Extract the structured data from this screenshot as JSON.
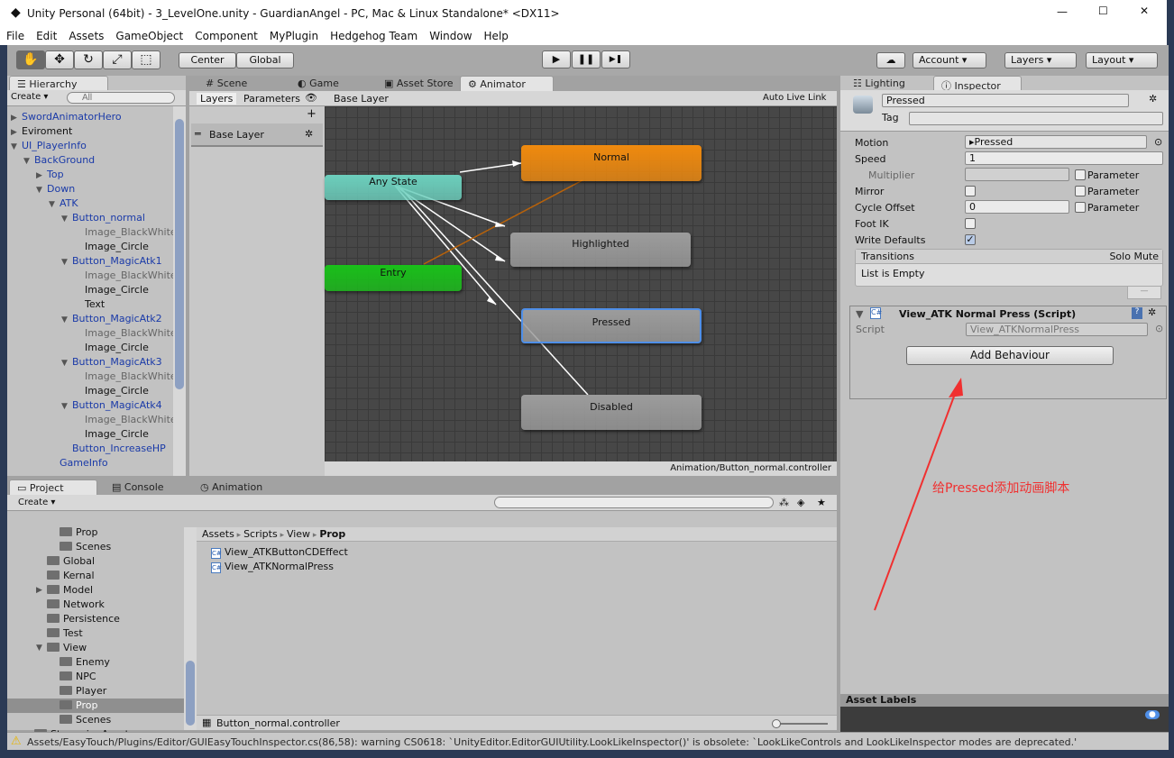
{
  "window": {
    "title": "Unity Personal (64bit) - 3_LevelOne.unity - GuardianAngel - PC, Mac & Linux Standalone* <DX11>",
    "controls": [
      "—",
      "☐",
      "✕"
    ]
  },
  "menu": [
    "File",
    "Edit",
    "Assets",
    "GameObject",
    "Component",
    "MyPlugin",
    "Hedgehog Team",
    "Window",
    "Help"
  ],
  "toolbar": {
    "tools": [
      "✋",
      "✥",
      "↻",
      "⤢",
      "⬚"
    ],
    "pivot": "Center",
    "space": "Global",
    "play": "▶",
    "pause": "❚❚",
    "step": "▶❚",
    "account": "Account",
    "layers": "Layers",
    "layout": "Layout",
    "cloud": "☁"
  },
  "hierarchy": {
    "tab": "Hierarchy",
    "create": "Create",
    "search_placeholder": "All",
    "items": [
      {
        "label": "SwordAnimatorHero",
        "depth": 0,
        "arrow": "▶",
        "blue": true
      },
      {
        "label": "Eviroment",
        "depth": 0,
        "arrow": "▶",
        "blue": false
      },
      {
        "label": "UI_PlayerInfo",
        "depth": 0,
        "arrow": "▼",
        "blue": true
      },
      {
        "label": "BackGround",
        "depth": 1,
        "arrow": "▼",
        "blue": true
      },
      {
        "label": "Top",
        "depth": 2,
        "arrow": "▶",
        "blue": true
      },
      {
        "label": "Down",
        "depth": 2,
        "arrow": "▼",
        "blue": true
      },
      {
        "label": "ATK",
        "depth": 3,
        "arrow": "▼",
        "blue": true
      },
      {
        "label": "Button_normal",
        "depth": 4,
        "arrow": "▼",
        "blue": true
      },
      {
        "label": "Image_BlackWhite",
        "depth": 5,
        "arrow": "",
        "blue": false,
        "dim": true
      },
      {
        "label": "Image_Circle",
        "depth": 5,
        "arrow": "",
        "blue": false
      },
      {
        "label": "Button_MagicAtk1",
        "depth": 4,
        "arrow": "▼",
        "blue": true
      },
      {
        "label": "Image_BlackWhite",
        "depth": 5,
        "arrow": "",
        "blue": false,
        "dim": true
      },
      {
        "label": "Image_Circle",
        "depth": 5,
        "arrow": "",
        "blue": false
      },
      {
        "label": "Text",
        "depth": 5,
        "arrow": "",
        "blue": false
      },
      {
        "label": "Button_MagicAtk2",
        "depth": 4,
        "arrow": "▼",
        "blue": true
      },
      {
        "label": "Image_BlackWhite",
        "depth": 5,
        "arrow": "",
        "blue": false,
        "dim": true
      },
      {
        "label": "Image_Circle",
        "depth": 5,
        "arrow": "",
        "blue": false
      },
      {
        "label": "Button_MagicAtk3",
        "depth": 4,
        "arrow": "▼",
        "blue": true
      },
      {
        "label": "Image_BlackWhite",
        "depth": 5,
        "arrow": "",
        "blue": false,
        "dim": true
      },
      {
        "label": "Image_Circle",
        "depth": 5,
        "arrow": "",
        "blue": false
      },
      {
        "label": "Button_MagicAtk4",
        "depth": 4,
        "arrow": "▼",
        "blue": true
      },
      {
        "label": "Image_BlackWhite",
        "depth": 5,
        "arrow": "",
        "blue": false,
        "dim": true
      },
      {
        "label": "Image_Circle",
        "depth": 5,
        "arrow": "",
        "blue": false
      },
      {
        "label": "Button_IncreaseHP",
        "depth": 4,
        "arrow": "",
        "blue": true
      },
      {
        "label": "GameInfo",
        "depth": 3,
        "arrow": "",
        "blue": true
      }
    ]
  },
  "center_tabs": [
    "Scene",
    "Game",
    "Asset Store",
    "Animator"
  ],
  "animator": {
    "layers_tab": "Layers",
    "parameters_tab": "Parameters",
    "breadcrumb": "Base Layer",
    "auto_live_link": "Auto Live Link",
    "layer_name": "Base Layer",
    "add": "+",
    "footer": "Animation/Button_normal.controller",
    "states": {
      "any": "Any State",
      "entry": "Entry",
      "normal": "Normal",
      "highlighted": "Highlighted",
      "pressed": "Pressed",
      "disabled": "Disabled"
    },
    "colors": {
      "any": "#6ccfbd",
      "entry": "#19c019",
      "normal": "#f08a0e",
      "default": "#9c9c9c",
      "selected_outline": "#4f8fe8"
    }
  },
  "inspector": {
    "tabs": [
      "Lighting",
      "Inspector"
    ],
    "name": "Pressed",
    "tag_label": "Tag",
    "fields": {
      "motion_label": "Motion",
      "motion": "Pressed",
      "speed_label": "Speed",
      "speed": "1",
      "multiplier_label": "Multiplier",
      "mirror_label": "Mirror",
      "cycle_label": "Cycle Offset",
      "cycle": "0",
      "footik_label": "Foot IK",
      "write_label": "Write Defaults",
      "parameter": "Parameter"
    },
    "checks": {
      "mirror": false,
      "foot_ik": false,
      "write_defaults": true,
      "speed_param": false,
      "mirror_param": false,
      "cycle_param": false
    },
    "transitions": {
      "header": "Transitions",
      "solo_mute": "Solo Mute",
      "empty": "List is Empty",
      "remove": "—"
    },
    "script_component": {
      "title": "View_ATK Normal Press (Script)",
      "script_label": "Script",
      "script": "View_ATKNormalPress",
      "add_behaviour": "Add Behaviour"
    },
    "asset_labels": "Asset Labels"
  },
  "project": {
    "tabs": [
      "Project",
      "Console",
      "Animation"
    ],
    "create": "Create",
    "tree": [
      {
        "label": "Prop",
        "depth": 2
      },
      {
        "label": "Scenes",
        "depth": 2
      },
      {
        "label": "Global",
        "depth": 1
      },
      {
        "label": "Kernal",
        "depth": 1
      },
      {
        "label": "Model",
        "depth": 1,
        "arrow": "▶"
      },
      {
        "label": "Network",
        "depth": 1
      },
      {
        "label": "Persistence",
        "depth": 1
      },
      {
        "label": "Test",
        "depth": 1
      },
      {
        "label": "View",
        "depth": 1,
        "arrow": "▼"
      },
      {
        "label": "Enemy",
        "depth": 2
      },
      {
        "label": "NPC",
        "depth": 2
      },
      {
        "label": "Player",
        "depth": 2
      },
      {
        "label": "Prop",
        "depth": 2,
        "selected": true
      },
      {
        "label": "Scenes",
        "depth": 2
      },
      {
        "label": "StreamingAssets",
        "depth": 0
      }
    ],
    "breadcrumb": [
      "Assets",
      "Scripts",
      "View",
      "Prop"
    ],
    "files": [
      "View_ATKButtonCDEffect",
      "View_ATKNormalPress"
    ],
    "selected_file": "Button_normal.controller"
  },
  "status": "Assets/EasyTouch/Plugins/Editor/GUIEasyTouchInspector.cs(86,58): warning CS0618: `UnityEditor.EditorGUIUtility.LookLikeInspector()' is obsolete: `LookLikeControls and LookLikeInspector modes are deprecated.'",
  "annotation": {
    "text": "给Pressed添加动画脚本",
    "color": "#f03030"
  }
}
